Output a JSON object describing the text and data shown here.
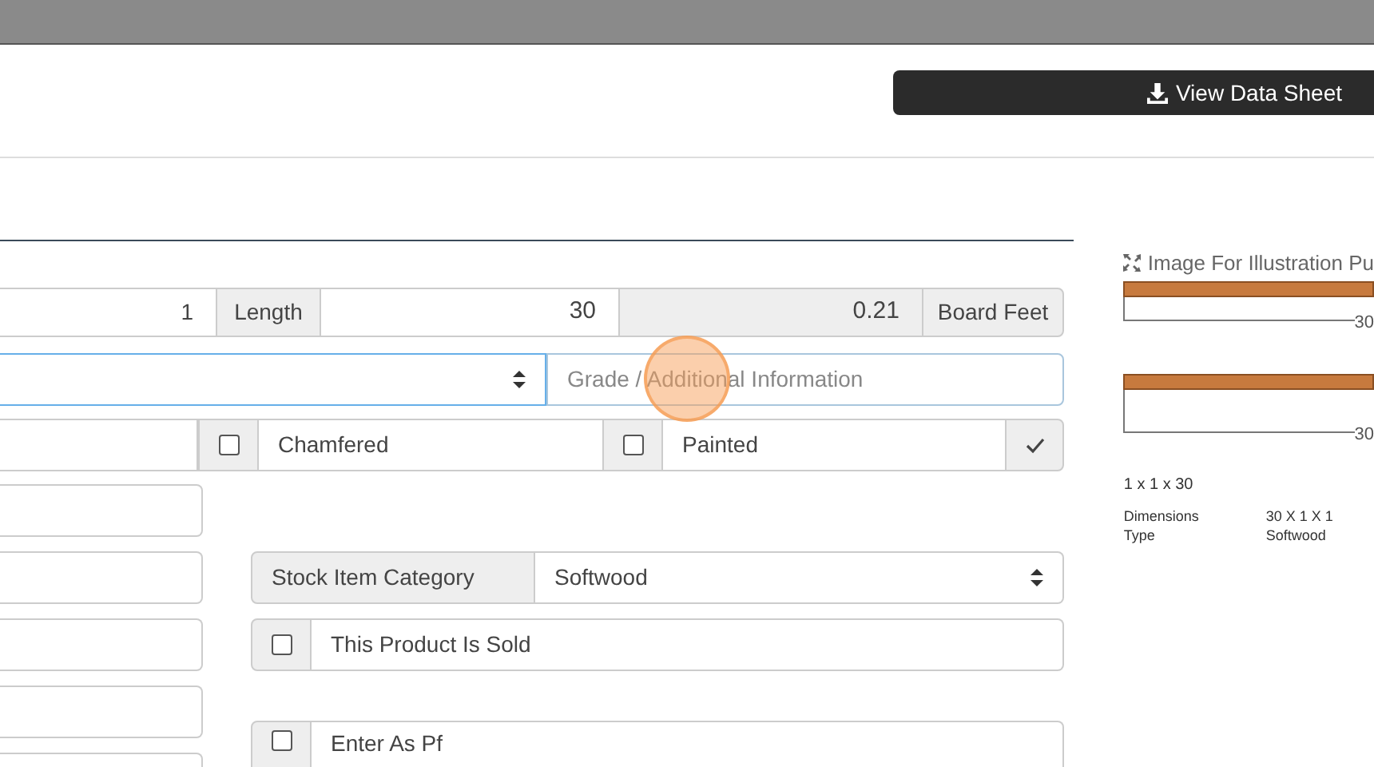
{
  "header": {
    "button": "View Data Sheet"
  },
  "form": {
    "row_1": {
      "quantity": "1",
      "length_label": "Length",
      "length": "30",
      "board_feet": "0.21",
      "board_feet_label": "Board Feet"
    },
    "row_2": {
      "focused": true,
      "grade_placeholder": "Grade / Additional Information"
    },
    "row_3": [
      {
        "label": "Chamfered",
        "checked": false
      },
      {
        "label": "Painted",
        "checked": false
      }
    ],
    "category": {
      "label": "Stock Item Category",
      "value": "Softwood"
    },
    "options": [
      {
        "label": "This Product Is Sold",
        "checked": false
      },
      {
        "label": "Enter As Pf",
        "checked": false
      }
    ]
  },
  "illustration": {
    "title": "Image For Illustration Pu",
    "drawings": [
      {
        "dimension": "30"
      },
      {
        "dimension": "30"
      }
    ],
    "size": "1 x 1 x 30",
    "specs": [
      {
        "name": "Dimensions",
        "value": "30 X 1 X 1"
      },
      {
        "name": "Type",
        "value": "Softwood"
      }
    ]
  }
}
